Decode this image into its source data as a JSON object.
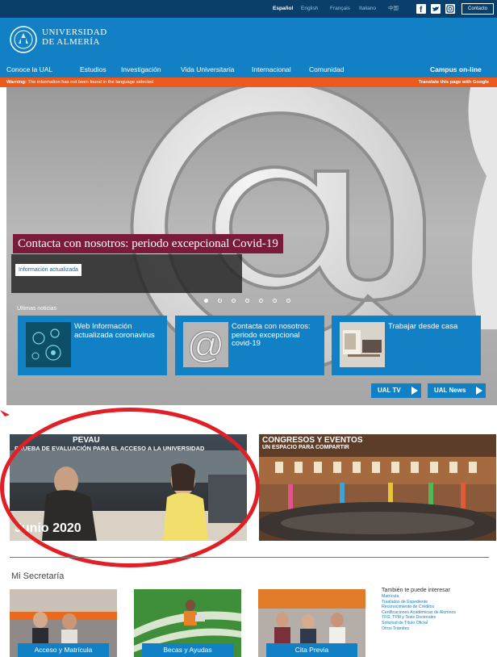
{
  "top_bar": {
    "languages": [
      "Español",
      "English",
      "Français",
      "Italiano",
      "中国"
    ],
    "active_language": "Español",
    "contact_label": "Contacto"
  },
  "header": {
    "logo_line1": "UNIVERSIDAD",
    "logo_line2": "DE ALMERÍA"
  },
  "nav": {
    "items": [
      "Conoce la UAL",
      "Estudios",
      "Investigación",
      "Vida Universitaria",
      "Internacional",
      "Comunidad"
    ],
    "campus": "Campus on-line"
  },
  "warning": {
    "label": "Warning:",
    "text": "The information has not been found in the language selected",
    "translate": "Translate this page with Google"
  },
  "hero": {
    "title": "Contacta con nosotros: periodo excepcional Covid-19",
    "button": "Información actualizada",
    "slides_total": 7,
    "slide_active": 1,
    "news_label": "Últimas noticias",
    "news": [
      {
        "title": "Web Información actualizada coronavirus",
        "thumb": "coronavirus-icon"
      },
      {
        "title": "Contacta con nosotros: periodo excepcional covid-19",
        "thumb": "at-sign-icon"
      },
      {
        "title": "Trabajar desde casa",
        "thumb": "workspace-photo"
      }
    ],
    "tv_label": "UAL TV",
    "news_btn_label": "UAL News"
  },
  "banners": {
    "pevau_title": "PEVAU",
    "pevau_subtitle": "PRUEBA DE EVALUACIÓN PARA EL ACCESO A LA UNIVERSIDAD",
    "pevau_date": "Junio 2020",
    "congresos_title": "CONGRESOS Y EVENTOS",
    "congresos_subtitle": "UN ESPACIO PARA COMPARTIR"
  },
  "secretaria": {
    "title": "Mi Secretaría",
    "cards": [
      "Acceso y Matrícula",
      "Becas y Ayudas",
      "Cita Previa"
    ],
    "interest_title": "También te puede interesar",
    "interest_links": [
      "Matrícula",
      "Traslados de Expediente",
      "Reconocimiento de Créditos",
      "Certificaciones Académicas de Alumnos",
      "TFG, TFM y Tesis Doctorales",
      "Solicitud de Título Oficial",
      "Otros Trámites"
    ]
  },
  "colors": {
    "brand_blue": "#1180c4",
    "dark_blue": "#0a3e6b",
    "warning_orange": "#ec5b1e",
    "hero_title_bg": "#7a1b3b",
    "annotation_red": "#e01f26"
  }
}
